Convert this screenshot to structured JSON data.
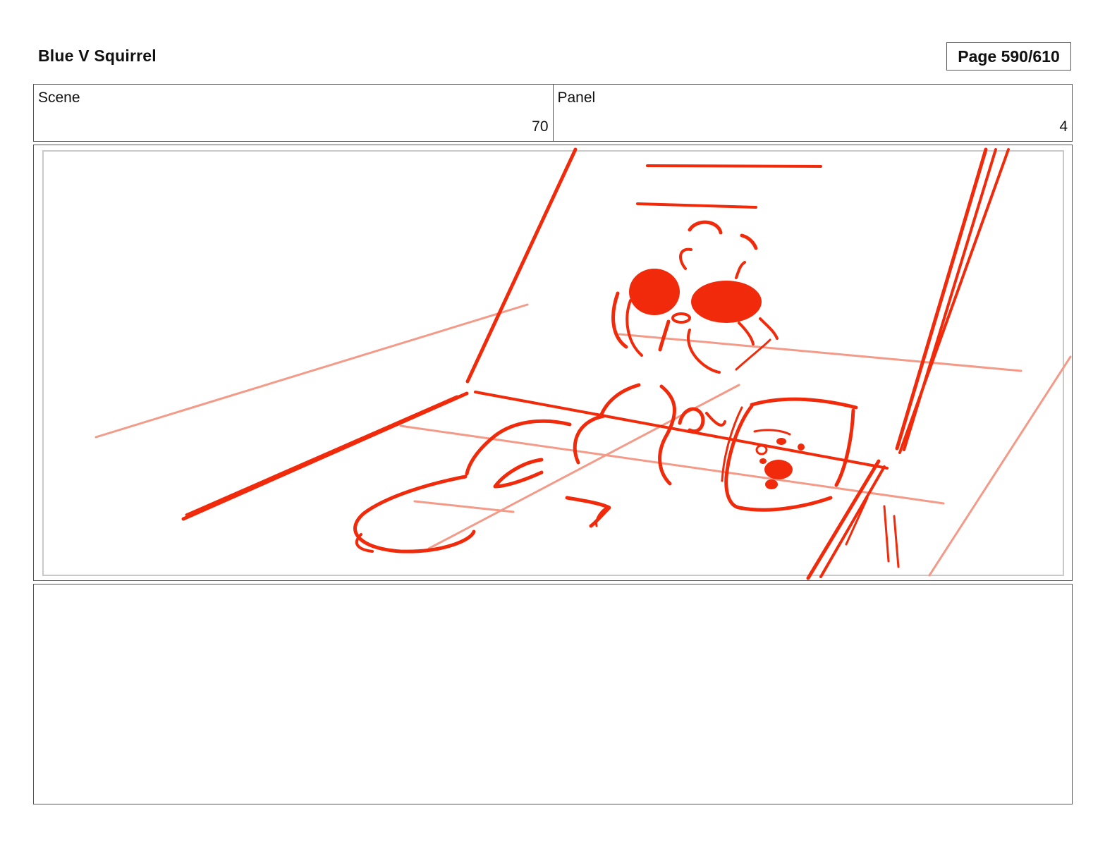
{
  "header": {
    "title": "Blue V Squirrel",
    "page_label": "Page 590/610"
  },
  "info": {
    "scene_label": "Scene",
    "scene_value": "70",
    "panel_label": "Panel",
    "panel_value": "4"
  },
  "colors": {
    "sketch": "#f02a0a",
    "sketch_light": "#f49a88"
  }
}
